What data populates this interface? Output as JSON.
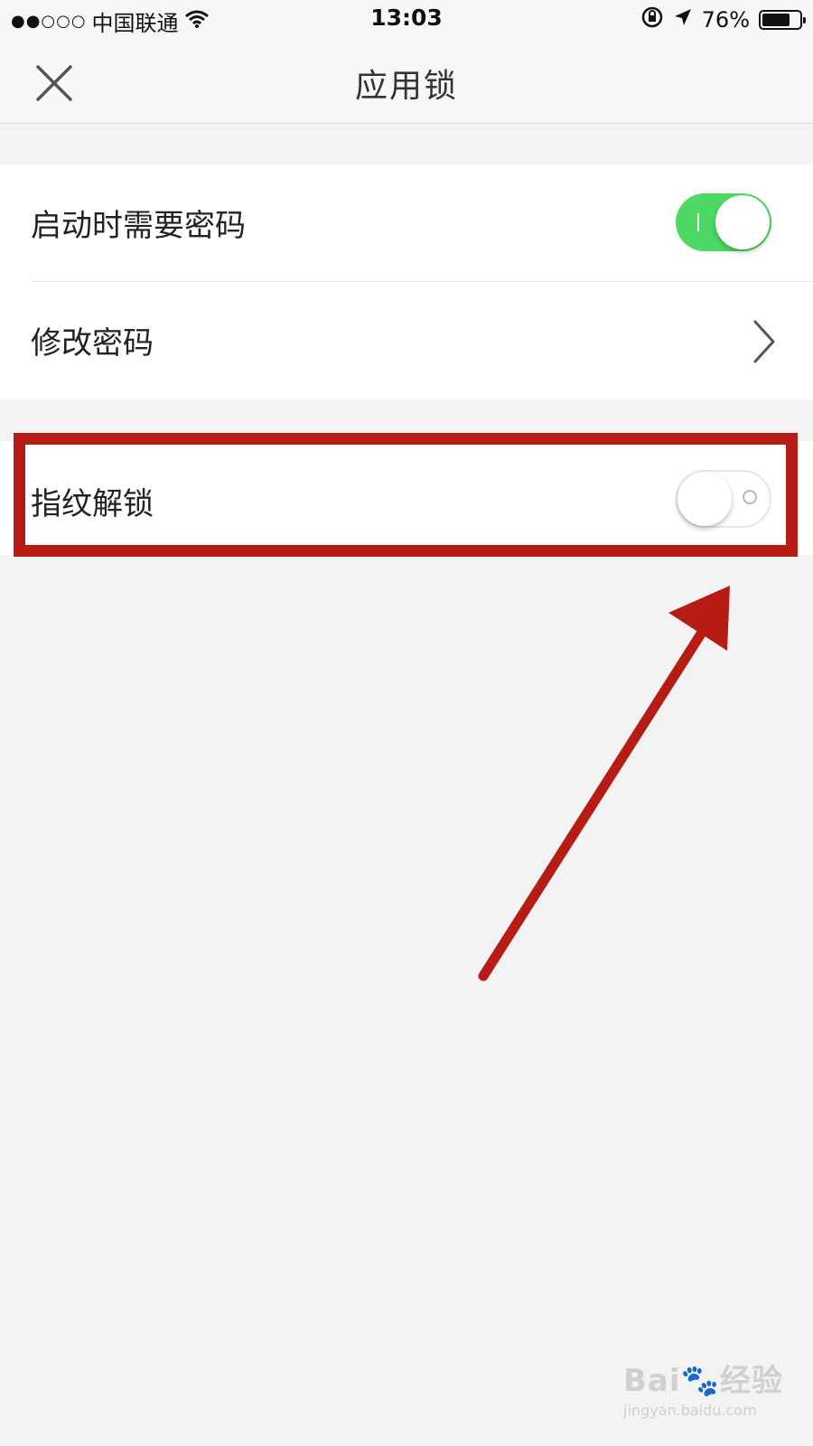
{
  "status_bar": {
    "signal": "●●○○○",
    "carrier": "中国联通",
    "wifi_icon": "wifi-icon",
    "time": "13:03",
    "orientation_lock_icon": "orientation-lock-icon",
    "location_icon": "location-arrow-icon",
    "battery_percent": "76%",
    "battery_level": 0.76
  },
  "nav": {
    "title": "应用锁",
    "close_icon": "close-icon"
  },
  "settings": {
    "require_password_on_launch": {
      "label": "启动时需要密码",
      "enabled": true
    },
    "change_password": {
      "label": "修改密码",
      "chevron_icon": "chevron-right-icon"
    },
    "fingerprint_unlock": {
      "label": "指纹解锁",
      "enabled": false
    }
  },
  "colors": {
    "toggle_on": "#4cd964",
    "annotation_red": "#b71c14",
    "background": "#f3f3f4"
  },
  "watermark": {
    "logo": "Bai🐾经验",
    "url": "jingyan.baidu.com"
  }
}
